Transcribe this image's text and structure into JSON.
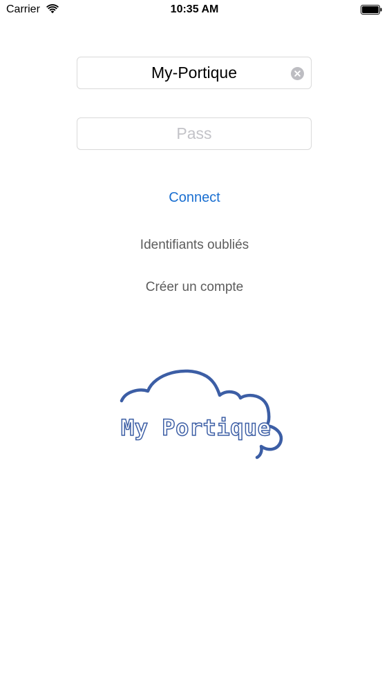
{
  "status_bar": {
    "carrier": "Carrier",
    "time": "10:35 AM",
    "icons": [
      "wifi-icon",
      "battery-icon"
    ]
  },
  "login": {
    "username_value": "My-Portique",
    "password_placeholder": "Pass",
    "connect_label": "Connect",
    "forgot_label": "Identifiants oubliés",
    "create_label": "Créer un compte"
  },
  "logo": {
    "text": "My Portique",
    "shape": "cloud-icon"
  },
  "colors": {
    "accent": "#1a6fd1",
    "secondary_text": "#5c5c5c",
    "logo_blue": "#3c5ea5",
    "placeholder": "#c3c3c8"
  }
}
